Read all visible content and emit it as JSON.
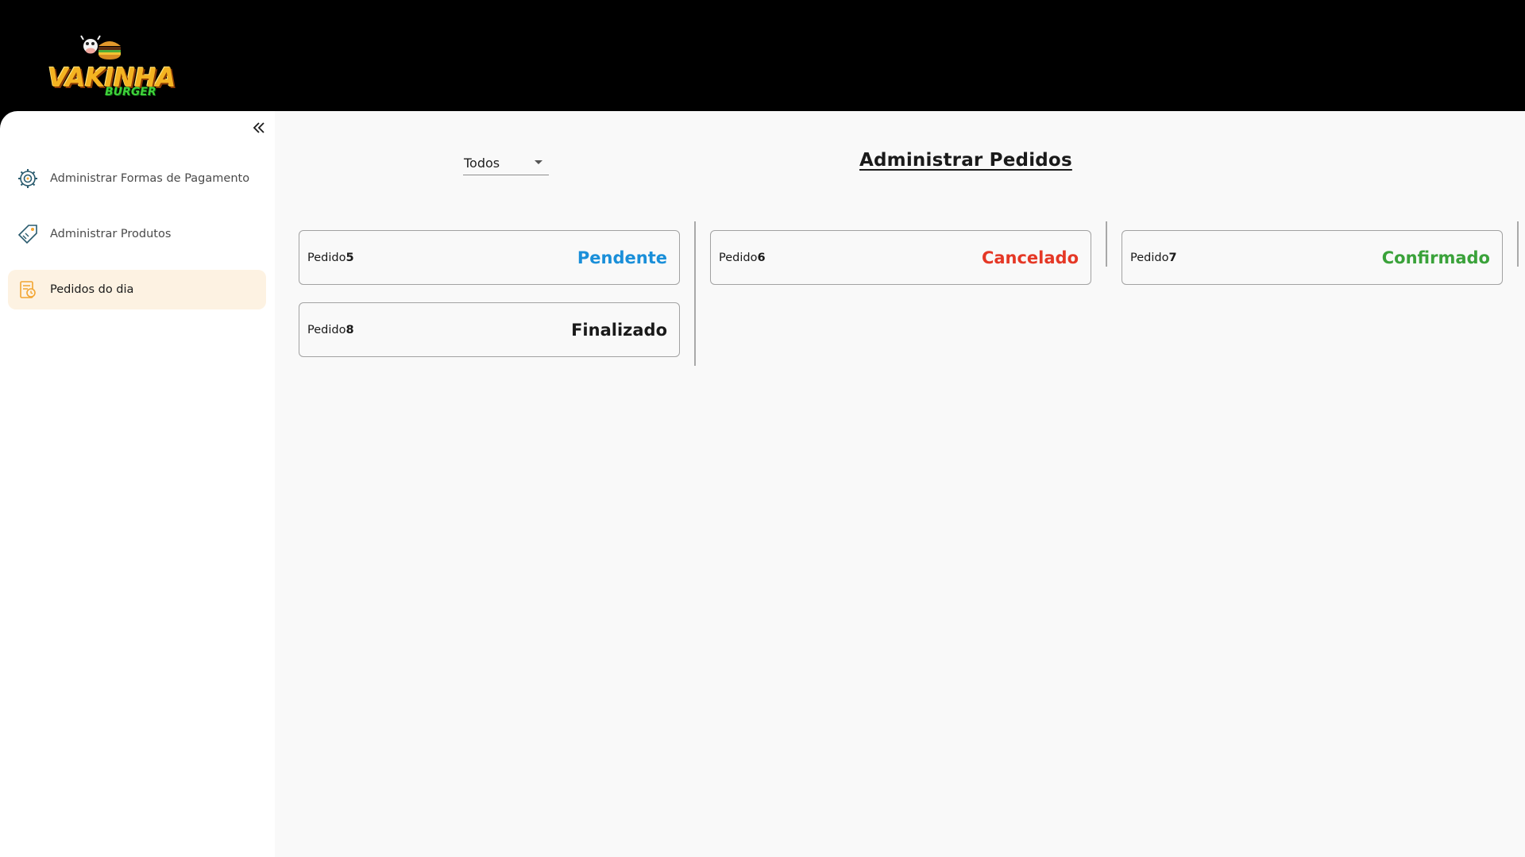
{
  "brand": {
    "logo_main": "VAKINHA",
    "logo_sub": "BURGER"
  },
  "sidebar": {
    "collapse_icon": "chevron-double-left-icon",
    "items": [
      {
        "label": "Administrar Formas de Pagamento",
        "icon": "gear-icon",
        "active": false
      },
      {
        "label": "Administrar Produtos",
        "icon": "tag-icon",
        "active": false
      },
      {
        "label": "Pedidos do dia",
        "icon": "receipt-icon",
        "active": true
      }
    ]
  },
  "main": {
    "filter": {
      "selected": "Todos"
    },
    "title": "Administrar Pedidos",
    "orders": [
      {
        "prefix": "Pedido",
        "number": "5",
        "status": "Pendente",
        "status_color": "#1a8fd9"
      },
      {
        "prefix": "Pedido",
        "number": "6",
        "status": "Cancelado",
        "status_color": "#e53826"
      },
      {
        "prefix": "Pedido",
        "number": "7",
        "status": "Confirmado",
        "status_color": "#3aa23a"
      },
      {
        "prefix": "Pedido",
        "number": "8",
        "status": "Finalizado",
        "status_color": "#1a1a1a"
      }
    ]
  },
  "colors": {
    "active_item_bg": "#fdf2e2",
    "icon_accent": "#f2a531",
    "icon_teal": "#2a5b6e"
  }
}
